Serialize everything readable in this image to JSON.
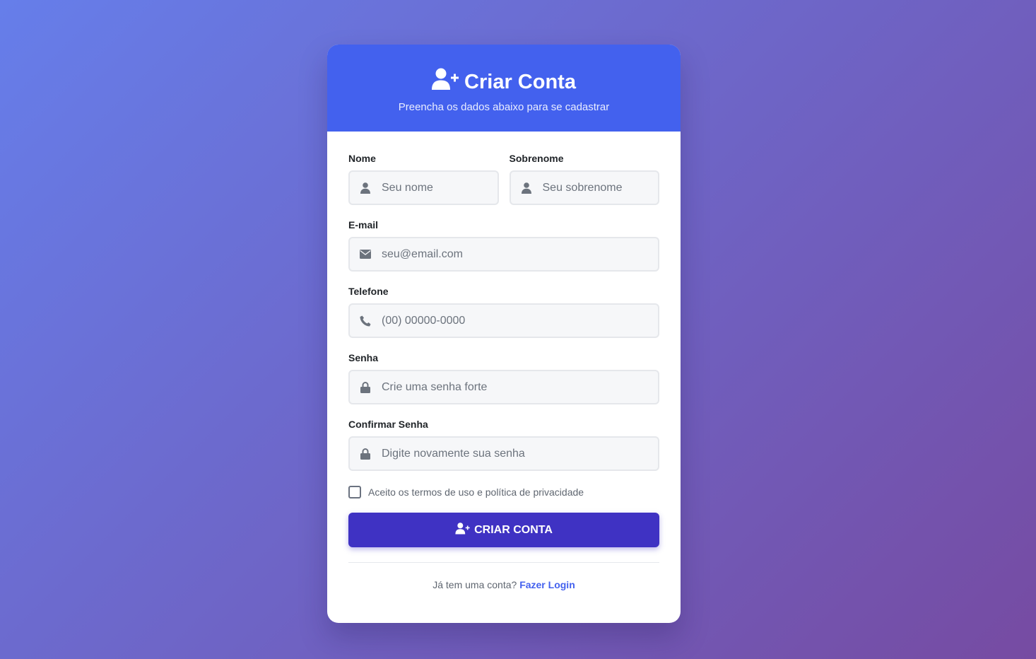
{
  "header": {
    "title": "Criar Conta",
    "subtitle": "Preencha os dados abaixo para se cadastrar",
    "icon": "user-plus-icon"
  },
  "form": {
    "first_name": {
      "label": "Nome",
      "placeholder": "Seu nome",
      "value": "",
      "icon": "user-icon"
    },
    "last_name": {
      "label": "Sobrenome",
      "placeholder": "Seu sobrenome",
      "value": "",
      "icon": "user-icon"
    },
    "email": {
      "label": "E-mail",
      "placeholder": "seu@email.com",
      "value": "",
      "icon": "envelope-icon"
    },
    "phone": {
      "label": "Telefone",
      "placeholder": "(00) 00000-0000",
      "value": "",
      "icon": "phone-icon"
    },
    "password": {
      "label": "Senha",
      "placeholder": "Crie uma senha forte",
      "value": "",
      "icon": "lock-icon"
    },
    "confirm_password": {
      "label": "Confirmar Senha",
      "placeholder": "Digite novamente sua senha",
      "value": "",
      "icon": "lock-icon"
    },
    "terms": {
      "label": "Aceito os termos de uso e política de privacidade",
      "checked": false
    },
    "submit_label": "CRIAR CONTA"
  },
  "footer": {
    "prompt": "Já tem uma conta?",
    "login_link": "Fazer Login"
  },
  "colors": {
    "header_bg": "#4361ee",
    "button_bg": "#3f32c3",
    "link": "#4361ee",
    "background_gradient": [
      "#667eea",
      "#764ba2"
    ]
  }
}
